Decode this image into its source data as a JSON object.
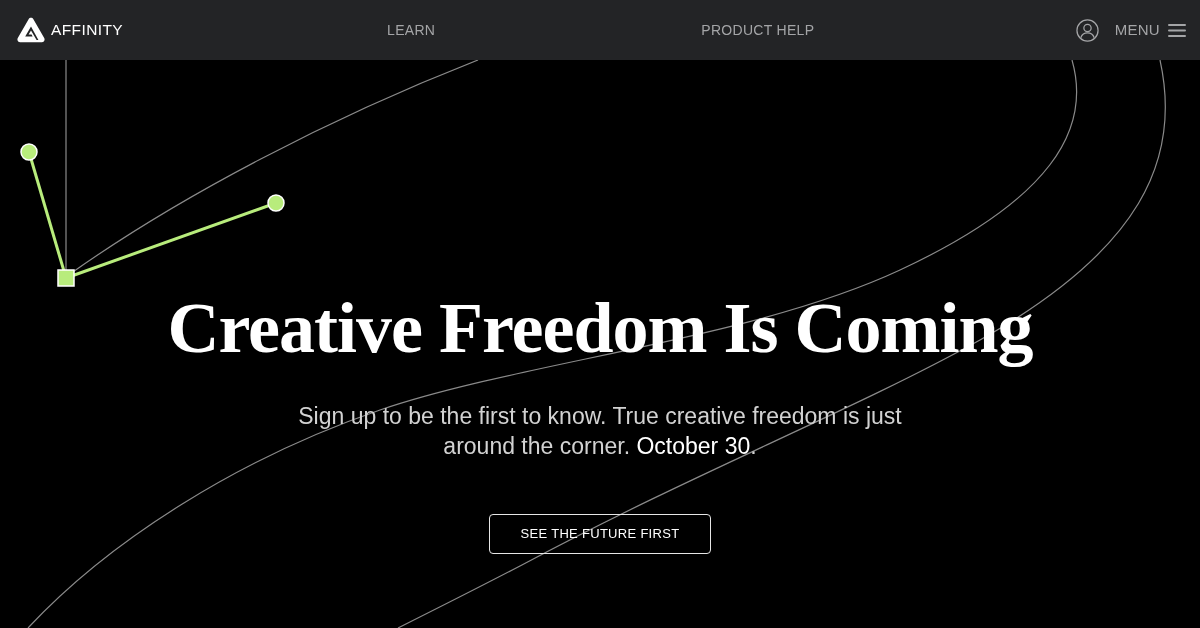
{
  "navbar": {
    "logo_text": "AFFINITY",
    "links": [
      "LEARN",
      "PRODUCT HELP"
    ],
    "menu_label": "MENU"
  },
  "hero": {
    "title": "Creative Freedom Is Coming",
    "subtitle": "Sign up to be the first to know. True creative freedom is just around the corner. **October 30**.",
    "button": "SEE THE FUTURE FIRST"
  }
}
